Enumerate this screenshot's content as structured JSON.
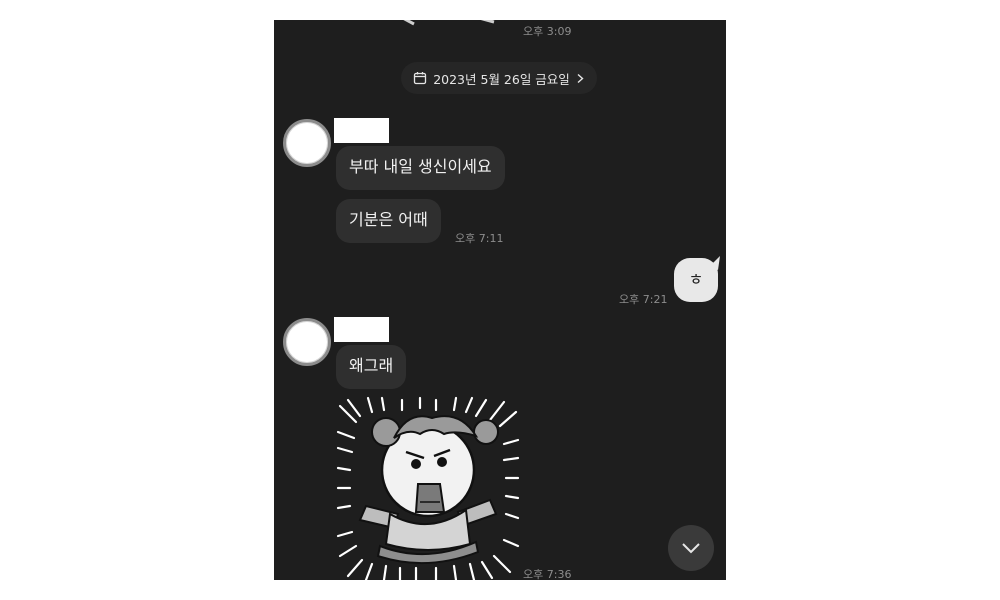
{
  "chat": {
    "prev_time": "오후 3:09",
    "date_divider": "2023년 5월 26일 금요일",
    "messages": [
      {
        "text": "부따 내일 생신이세요"
      },
      {
        "text": "기분은 어때",
        "time": "오후 7:11"
      },
      {
        "text": "ㅎ",
        "time": "오후 7:21"
      },
      {
        "text": "왜그래"
      },
      {
        "sticker": "angry-girl-sticker",
        "time": "오후 7:36"
      }
    ]
  },
  "icons": {
    "calendar": "calendar-icon",
    "chevron_right": "chevron-right-icon",
    "scroll_down": "chevron-down-icon"
  },
  "colors": {
    "background": "#1e1e1e",
    "incoming_bubble": "#2f2f2f",
    "outgoing_bubble": "#e8e8e8"
  }
}
